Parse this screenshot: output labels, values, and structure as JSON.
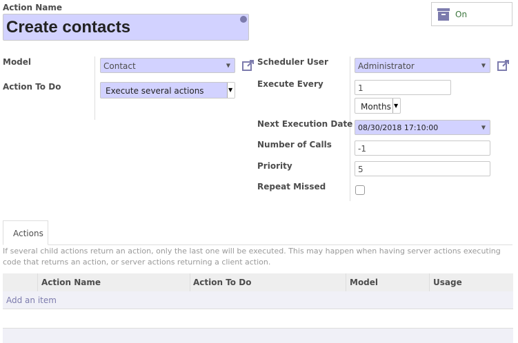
{
  "form": {
    "action_name_label": "Action Name",
    "action_name_value": "Create contacts",
    "status_label": "On"
  },
  "left": {
    "model_label": "Model",
    "model_value": "Contact",
    "action_todo_label": "Action To Do",
    "action_todo_value": "Execute several actions"
  },
  "right": {
    "scheduler_user_label": "Scheduler User",
    "scheduler_user_value": "Administrator",
    "execute_every_label": "Execute Every",
    "execute_every_value": "1",
    "execute_every_unit": "Months",
    "next_exec_label": "Next Execution Date",
    "next_exec_value": "08/30/2018 17:10:00",
    "num_calls_label": "Number of Calls",
    "num_calls_value": "-1",
    "priority_label": "Priority",
    "priority_value": "5",
    "repeat_missed_label": "Repeat Missed"
  },
  "tabs": {
    "actions_label": "Actions"
  },
  "help_text": "If several child actions return an action, only the last one will be executed. This may happen when having server actions executing code that returns an action, or server actions returning a client action.",
  "table": {
    "headers": [
      "Action Name",
      "Action To Do",
      "Model",
      "Usage"
    ],
    "add_item": "Add an item"
  },
  "colors": {
    "accent": "#7c7bad",
    "required_field": "#d2d2ff",
    "status_green": "#3c763d"
  }
}
